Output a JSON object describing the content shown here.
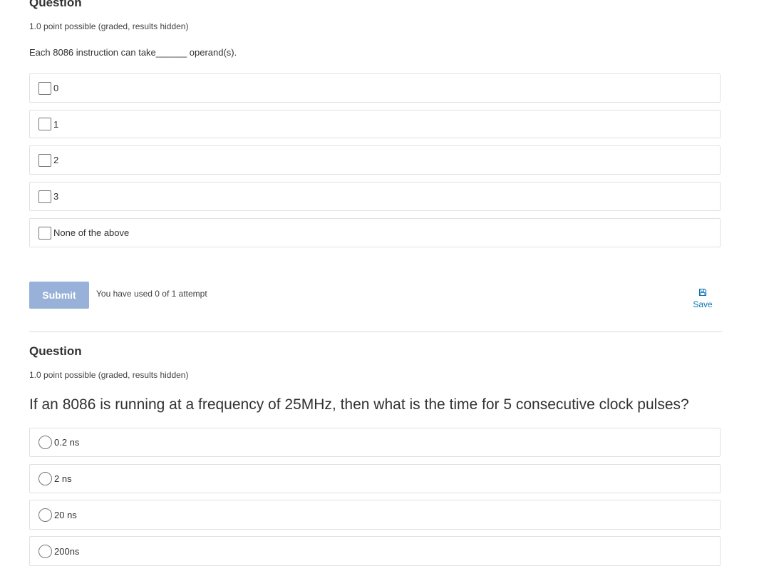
{
  "question1": {
    "title": "Question",
    "meta": "1.0 point possible (graded, results hidden)",
    "prompt": "Each 8086 instruction can take______ operand(s).",
    "input_type": "checkbox",
    "choices": [
      {
        "label": "0",
        "checked": false
      },
      {
        "label": "1",
        "checked": false
      },
      {
        "label": "2",
        "checked": false
      },
      {
        "label": "3",
        "checked": false
      },
      {
        "label": "None of the above",
        "checked": false
      }
    ],
    "submit_label": "Submit",
    "attempts_text": "You have used 0 of 1 attempt",
    "save_label": "Save",
    "save_icon": "floppy-disk-icon"
  },
  "question2": {
    "title": "Question",
    "meta": "1.0 point possible (graded, results hidden)",
    "prompt": "If an 8086 is running at a frequency of 25MHz, then what is the time for 5 consecutive clock pulses?",
    "input_type": "radio",
    "choices": [
      {
        "label": "0.2 ns",
        "checked": false
      },
      {
        "label": "2 ns",
        "checked": false
      },
      {
        "label": "20 ns",
        "checked": false
      },
      {
        "label": "200ns",
        "checked": false
      }
    ]
  },
  "colors": {
    "submit_bg": "#98b1d8",
    "link": "#0e75b5",
    "border": "#e1e1e1"
  }
}
